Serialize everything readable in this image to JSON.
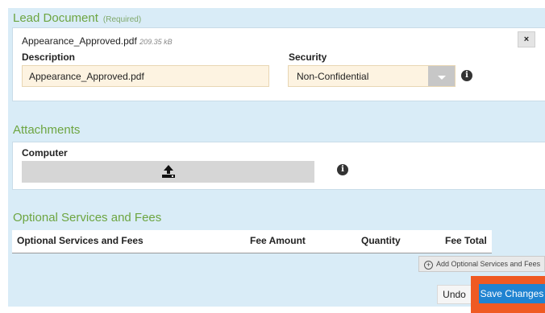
{
  "lead_document": {
    "title": "Lead Document",
    "required": "(Required)",
    "file_name": "Appearance_Approved.pdf",
    "file_size": "209.35 kB",
    "description_label": "Description",
    "description_value": "Appearance_Approved.pdf",
    "security_label": "Security",
    "security_value": "Non-Confidential",
    "remove_label": "×"
  },
  "attachments": {
    "title": "Attachments",
    "computer_label": "Computer"
  },
  "optional_services": {
    "title": "Optional Services and Fees",
    "columns": [
      "Optional Services and Fees",
      "Fee Amount",
      "Quantity",
      "Fee Total"
    ],
    "add_label": "Add Optional Services and Fees"
  },
  "actions": {
    "undo_label": "Undo",
    "save_label": "Save Changes"
  },
  "colors": {
    "accent": "#1f83d1",
    "highlight": "#ef5a23",
    "section_title": "#6da541"
  }
}
